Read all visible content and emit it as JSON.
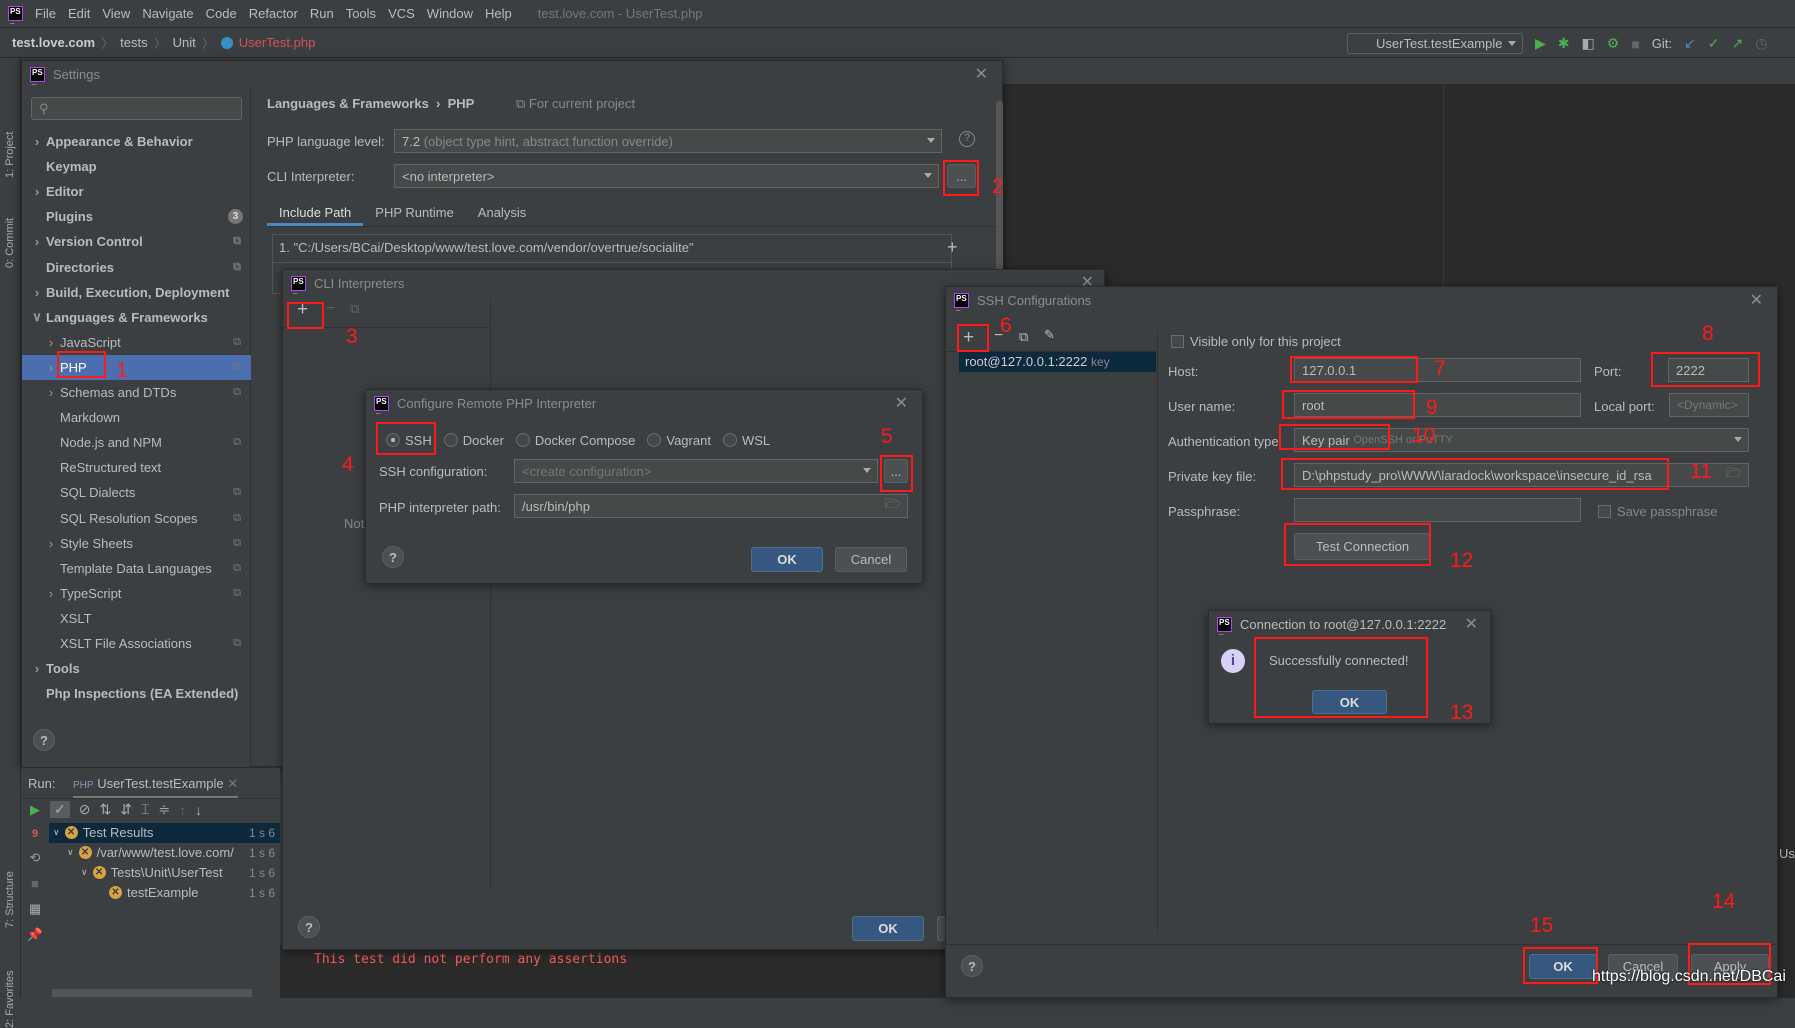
{
  "menu": {
    "items": [
      "File",
      "Edit",
      "View",
      "Navigate",
      "Code",
      "Refactor",
      "Run",
      "Tools",
      "VCS",
      "Window",
      "Help"
    ],
    "window_title": "test.love.com - UserTest.php"
  },
  "breadcrumb": {
    "items": [
      "test.love.com",
      "tests",
      "Unit"
    ],
    "file": "UserTest.php"
  },
  "toolbar": {
    "run_config": "UserTest.testExample",
    "git_label": "Git:",
    "icons": [
      "run-icon",
      "debug-icon",
      "coverage-icon",
      "profile-icon",
      "stop-icon",
      "git-update-icon",
      "git-commit-icon",
      "git-push-icon",
      "history-icon"
    ]
  },
  "toolstrip": {
    "project": "1: Project",
    "commit": "0: Commit",
    "structure": "7: Structure",
    "favorites": "2: Favorites"
  },
  "settings": {
    "title": "Settings",
    "search_placeholder": "",
    "sidebar": [
      {
        "label": "Appearance & Behavior",
        "arrow": "collapsed"
      },
      {
        "label": "Keymap"
      },
      {
        "label": "Editor",
        "arrow": "collapsed"
      },
      {
        "label": "Plugins",
        "badge": "3"
      },
      {
        "label": "Version Control",
        "arrow": "collapsed",
        "project": true
      },
      {
        "label": "Directories",
        "project": true
      },
      {
        "label": "Build, Execution, Deployment",
        "arrow": "collapsed"
      },
      {
        "label": "Languages & Frameworks",
        "arrow": "expanded"
      },
      {
        "label": "JavaScript",
        "sub": true,
        "arrow": "collapsed",
        "project": true
      },
      {
        "label": "PHP",
        "sub": true,
        "arrow": "collapsed",
        "project": true,
        "selected": true
      },
      {
        "label": "Schemas and DTDs",
        "sub": true,
        "arrow": "collapsed",
        "project": true
      },
      {
        "label": "Markdown",
        "sub": true
      },
      {
        "label": "Node.js and NPM",
        "sub": true,
        "project": true
      },
      {
        "label": "ReStructured text",
        "sub": true
      },
      {
        "label": "SQL Dialects",
        "sub": true,
        "project": true
      },
      {
        "label": "SQL Resolution Scopes",
        "sub": true,
        "project": true
      },
      {
        "label": "Style Sheets",
        "sub": true,
        "arrow": "collapsed",
        "project": true
      },
      {
        "label": "Template Data Languages",
        "sub": true,
        "project": true
      },
      {
        "label": "TypeScript",
        "sub": true,
        "arrow": "collapsed",
        "project": true
      },
      {
        "label": "XSLT",
        "sub": true
      },
      {
        "label": "XSLT File Associations",
        "sub": true,
        "project": true
      },
      {
        "label": "Tools",
        "arrow": "collapsed"
      },
      {
        "label": "Php Inspections (EA Extended)"
      }
    ],
    "page": {
      "crumb1": "Languages & Frameworks",
      "crumb2": "PHP",
      "scope": "For current project",
      "lang_level_label": "PHP language level:",
      "lang_level_value": "7.2",
      "lang_level_hint": "(object type hint, abstract function override)",
      "cli_label": "CLI Interpreter:",
      "cli_value": "<no interpreter>",
      "more": "...",
      "tabs": [
        "Include Path",
        "PHP Runtime",
        "Analysis"
      ],
      "active_tab": "Include Path",
      "include_paths": [
        "1. \"C:/Users/BCai/Desktop/www/test.love.com/vendor/overtrue/socialite\""
      ]
    }
  },
  "cli_dialog": {
    "title": "CLI Interpreters",
    "empty_text": "Not",
    "ok": "OK"
  },
  "remote_dialog": {
    "title": "Configure Remote PHP Interpreter",
    "options": [
      "SSH",
      "Docker",
      "Docker Compose",
      "Vagrant",
      "WSL"
    ],
    "selected": "SSH",
    "ssh_label": "SSH configuration:",
    "ssh_value": "<create configuration>",
    "more": "...",
    "path_label": "PHP interpreter path:",
    "path_value": "/usr/bin/php",
    "ok": "OK",
    "cancel": "Cancel"
  },
  "ssh_dialog": {
    "title": "SSH Configurations",
    "list": [
      {
        "name": "root@127.0.0.1:2222",
        "type": "key"
      }
    ],
    "visible_only": "Visible only for this project",
    "host_label": "Host:",
    "host": "127.0.0.1",
    "port_label": "Port:",
    "port": "2222",
    "user_label": "User name:",
    "user": "root",
    "local_port_label": "Local port:",
    "local_port_placeholder": "<Dynamic>",
    "auth_label": "Authentication type:",
    "auth_value": "Key pair",
    "auth_hint": "OpenSSH or PuTTY",
    "key_label": "Private key file:",
    "key_value": "D:\\phpstudy_pro\\WWW\\laradock\\workspace\\insecure_id_rsa",
    "pass_label": "Passphrase:",
    "pass_value": "",
    "save_pass": "Save passphrase",
    "test": "Test Connection",
    "ok": "OK",
    "cancel": "Cancel",
    "apply": "Apply"
  },
  "conn_dialog": {
    "title": "Connection to root@127.0.0.1:2222",
    "message": "Successfully connected!",
    "ok": "OK"
  },
  "run_panel": {
    "label": "Run:",
    "tab": "UserTest.testExample",
    "tree": [
      {
        "label": "Test Results",
        "time": "1 s 6"
      },
      {
        "label": "/var/www/test.love.com/",
        "time": "1 s 6"
      },
      {
        "label": "Tests\\Unit\\UserTest",
        "time": "1 s 6"
      },
      {
        "label": "testExample",
        "time": "1 s 6"
      }
    ],
    "failed_count": "9"
  },
  "console": {
    "line": "This test did not perform any assertions"
  },
  "editor_right_text": "Us",
  "annotations": [
    "1",
    "2",
    "3",
    "4",
    "5",
    "6",
    "7",
    "8",
    "9",
    "10",
    "11",
    "12",
    "13",
    "14",
    "15"
  ],
  "watermark": "https://blog.csdn.net/DBCai",
  "colors": {
    "background": "#3c3f41",
    "editor": "#2b2b2b",
    "selection": "#4b6eaf",
    "primary_button": "#365880",
    "annotation": "#ff1a1a",
    "error_text": "#ff5b5b"
  }
}
